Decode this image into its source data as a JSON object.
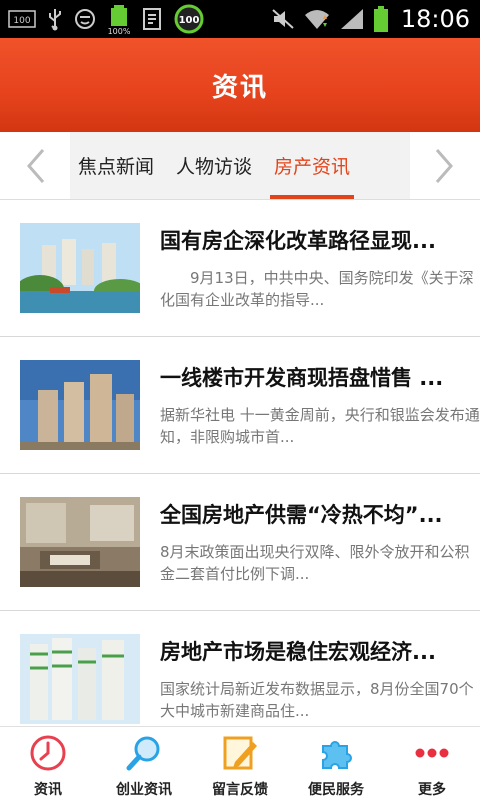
{
  "status_bar": {
    "time": "18:06",
    "icons": [
      "screen-100-icon",
      "usb-icon",
      "face-icon",
      "battery-100-icon",
      "app-icon",
      "badge-100-icon",
      "mute-icon",
      "wifi-icon",
      "signal-icon",
      "battery-icon"
    ],
    "battery_small_label": "100%",
    "badge_label": "100"
  },
  "header": {
    "title": "资讯"
  },
  "tabs": {
    "items": [
      {
        "label": "焦点新闻",
        "active": false
      },
      {
        "label": "人物访谈",
        "active": false
      },
      {
        "label": "房产资讯",
        "active": true
      }
    ],
    "accent": "#e2441a"
  },
  "articles": [
    {
      "title": "国有房企深化改革路径显现...",
      "summary": "9月13日，中共中央、国务院印发《关于深化国有企业改革的指导..."
    },
    {
      "title": "一线楼市开发商现捂盘惜售 ...",
      "summary": "据新华社电 十一黄金周前，央行和银监会发布通知，非限购城市首..."
    },
    {
      "title": "全国房地产供需“冷热不均”...",
      "summary": "8月末政策面出现央行双降、限外令放开和公积金二套首付比例下调..."
    },
    {
      "title": "房地产市场是稳住宏观经济...",
      "summary": "国家统计局新近发布数据显示，8月份全国70个大中城市新建商品住..."
    }
  ],
  "bottom_nav": [
    {
      "label": "资讯",
      "icon": "clock-icon",
      "color": "#e8404f"
    },
    {
      "label": "创业资讯",
      "icon": "magnifier-icon",
      "color": "#2aa3e6"
    },
    {
      "label": "留言反馈",
      "icon": "note-pencil-icon",
      "color": "#f0a020"
    },
    {
      "label": "便民服务",
      "icon": "puzzle-icon",
      "color": "#2aa3e6"
    },
    {
      "label": "更多",
      "icon": "more-dots-icon",
      "color": "#e83040"
    }
  ]
}
